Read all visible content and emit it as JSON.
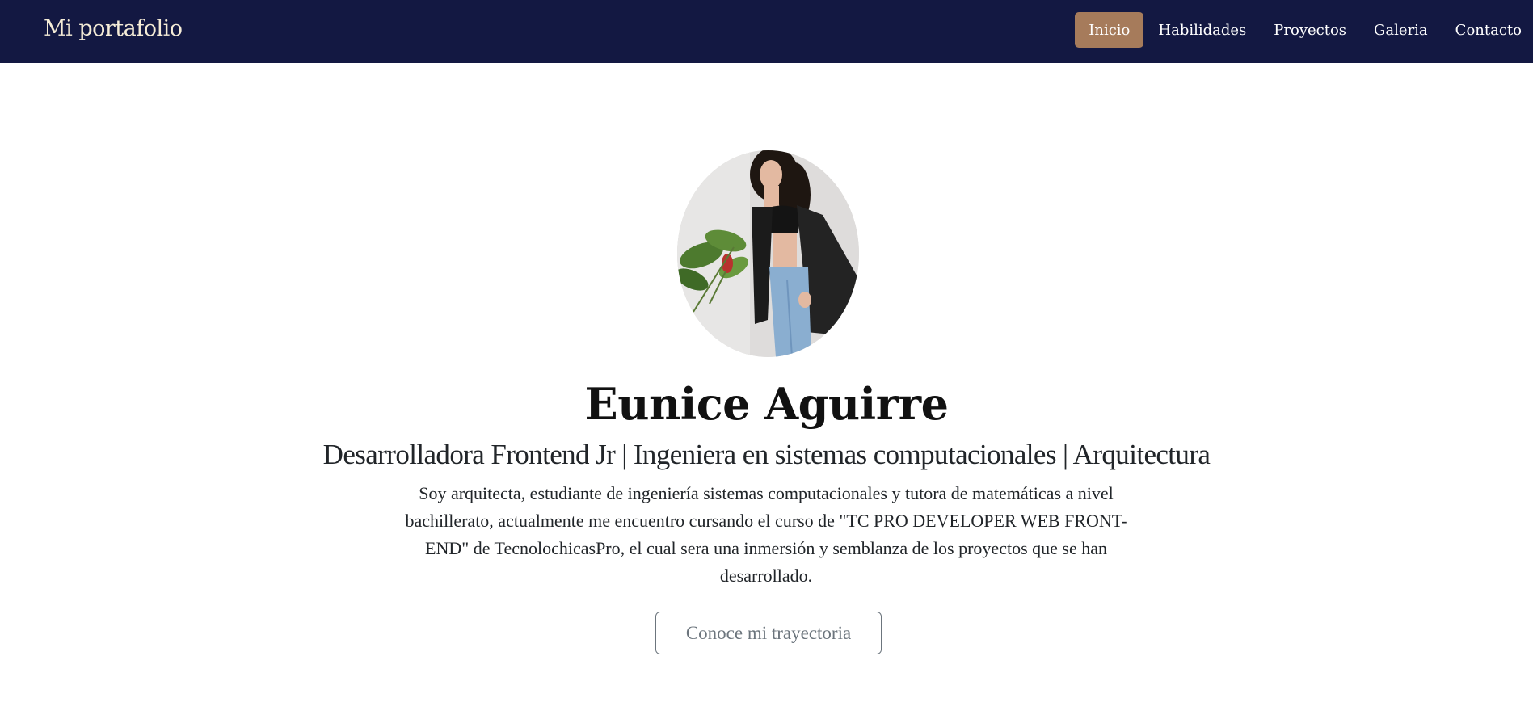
{
  "navbar": {
    "brand": "Mi portafolio",
    "links": [
      {
        "label": "Inicio",
        "active": true
      },
      {
        "label": "Habilidades",
        "active": false
      },
      {
        "label": "Proyectos",
        "active": false
      },
      {
        "label": "Galeria",
        "active": false
      },
      {
        "label": "Contacto",
        "active": false
      }
    ]
  },
  "hero": {
    "name": "Eunice Aguirre",
    "subtitle": "Desarrolladora Frontend Jr | Ingeniera en sistemas computacionales | Arquitectura",
    "description": "Soy arquitecta, estudiante de ingeniería sistemas computacionales y tutora de matemáticas a nivel bachillerato, actualmente me encuentro cursando el curso de \"TC PRO DEVELOPER WEB FRONT-END\" de TecnolochicasPro, el cual sera una inmersión y semblanza de los proyectos que se han desarrollado.",
    "cta_label": "Conoce mi trayectoria"
  },
  "colors": {
    "navbar_bg": "#131842",
    "active_link_bg": "#a67b5b",
    "brand_text": "#f5ecd7",
    "outline_button": "#6c757d"
  }
}
